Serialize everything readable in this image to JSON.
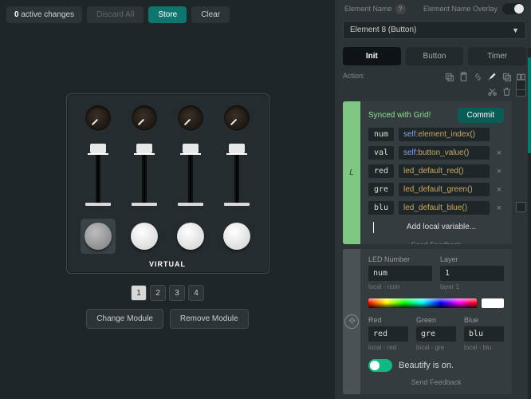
{
  "topbar": {
    "changes_count": "0",
    "changes_label": "active changes",
    "discard": "Discard All",
    "store": "Store",
    "clear": "Clear"
  },
  "module": {
    "label": "VIRTUAL",
    "pages": [
      "1",
      "2",
      "3",
      "4"
    ],
    "change": "Change Module",
    "remove": "Remove Module"
  },
  "panel": {
    "elname_label": "Element Name",
    "overlay_label": "Element Name Overlay",
    "element_select": "Element 8 (Button)",
    "tabs": {
      "init": "Init",
      "button": "Button",
      "timer": "Timer"
    },
    "action_label": "Action:",
    "synced": "Synced with Grid!",
    "commit": "Commit",
    "vars": [
      {
        "name": "num",
        "code_self": "self",
        "code_fn": ":element_index()",
        "closable": false
      },
      {
        "name": "val",
        "code_self": "self",
        "code_fn": ":button_value()",
        "closable": true
      },
      {
        "name": "red",
        "code_self": "",
        "code_fn": "led_default_red()",
        "closable": true
      },
      {
        "name": "gre",
        "code_self": "",
        "code_fn": "led_default_green()",
        "closable": true
      },
      {
        "name": "blu",
        "code_self": "",
        "code_fn": "led_default_blue()",
        "closable": true
      }
    ],
    "addvar": "Add local variable...",
    "feedback": "Send Feedback",
    "led": {
      "number_label": "LED Number",
      "layer_label": "Layer",
      "number_val": "num",
      "layer_val": "1",
      "number_sub": "local - num",
      "layer_sub": "layer 1",
      "red_label": "Red",
      "green_label": "Green",
      "blue_label": "Blue",
      "red_val": "red",
      "green_val": "gre",
      "blue_val": "blu",
      "red_sub": "local - red",
      "green_sub": "local - gre",
      "blue_sub": "local - blu",
      "beautify": "Beautify is on."
    },
    "sidechar": "L"
  }
}
